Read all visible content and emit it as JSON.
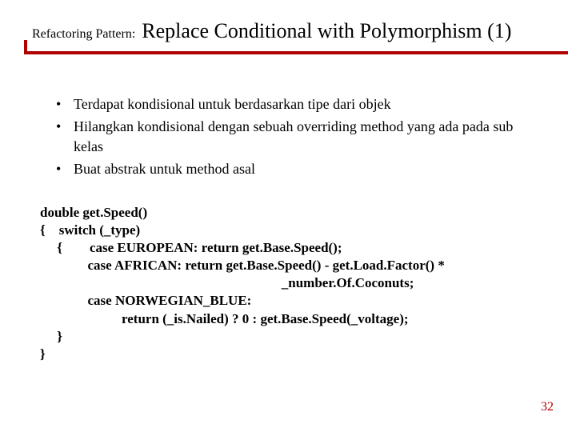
{
  "title": {
    "small": "Refactoring Pattern:",
    "large": "Replace Conditional with Polymorphism (1)"
  },
  "bullets": [
    "Terdapat kondisional untuk berdasarkan tipe dari objek",
    "Hilangkan kondisional dengan sebuah overriding method yang ada pada sub kelas",
    "Buat abstrak untuk method asal"
  ],
  "code": "double get.Speed()\n{    switch (_type)\n     {        case EUROPEAN: return get.Base.Speed();\n              case AFRICAN: return get.Base.Speed() - get.Load.Factor() *\n                                                                       _number.Of.Coconuts;\n              case NORWEGIAN_BLUE:\n                        return (_is.Nailed) ? 0 : get.Base.Speed(_voltage);\n     }\n}",
  "page_number": "32",
  "colors": {
    "accent": "#b00000"
  }
}
